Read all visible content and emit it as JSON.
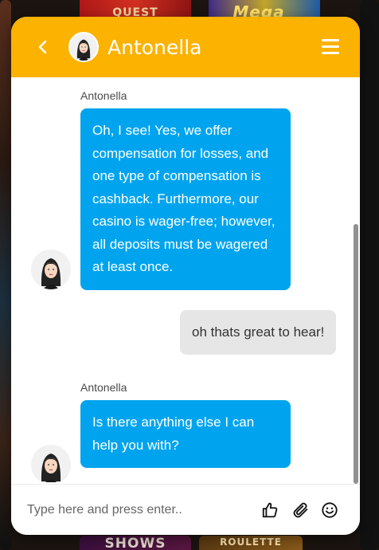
{
  "background": {
    "tile_labels": [
      "QUEST",
      "Mega",
      "SHOWS",
      "ROULETTE"
    ]
  },
  "header": {
    "agent_name": "Antonella",
    "color": "#fbb200"
  },
  "messages": [
    {
      "from": "bot",
      "sender": "Antonella",
      "text": "Oh, I see! Yes, we offer compensation for losses, and one type of compensation is cashback. Furthermore, our casino is wager-free; however, all deposits must be wagered at least once."
    },
    {
      "from": "user",
      "text": "oh thats great to hear!"
    },
    {
      "from": "bot",
      "sender": "Antonella",
      "text": "Is there anything else I can help you with?"
    }
  ],
  "composer": {
    "placeholder": "Type here and press enter..",
    "icons": [
      "thumbs-up-icon",
      "paperclip-icon",
      "smiley-icon"
    ]
  },
  "colors": {
    "bot_bubble": "#00a4ee",
    "user_bubble": "#e6e6e6"
  }
}
